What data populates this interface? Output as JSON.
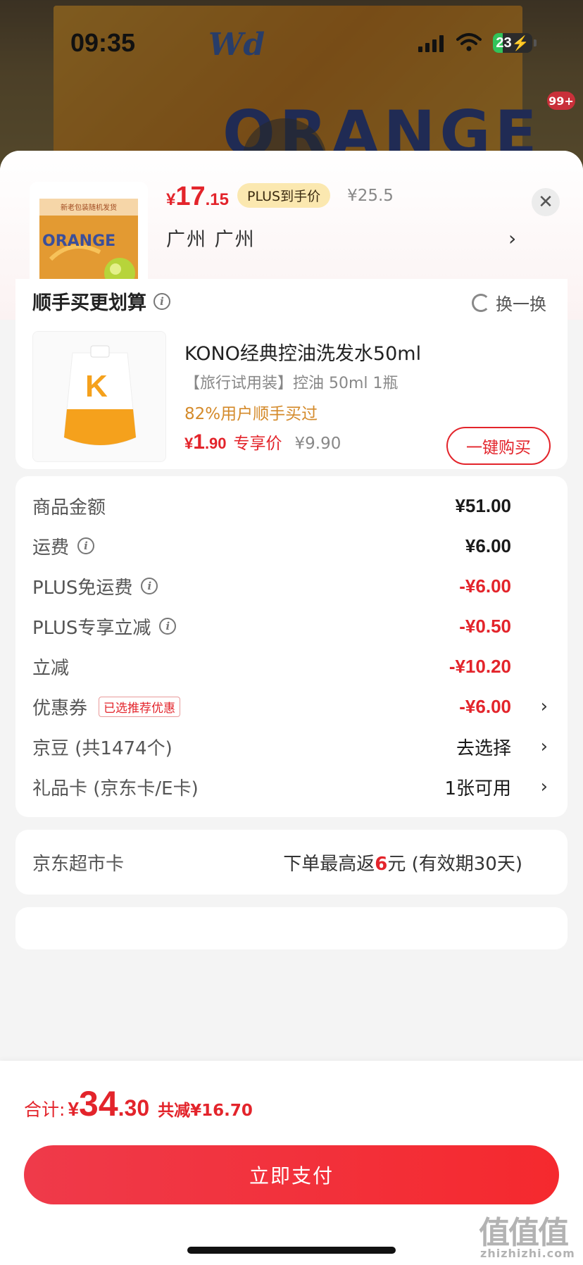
{
  "status_bar": {
    "time": "09:35",
    "battery": "23"
  },
  "background": {
    "badge": "99+"
  },
  "header": {
    "price_currency": "¥",
    "price_int": "17",
    "price_dec": ".15",
    "plus_tag": "PLUS到手价",
    "original_price": "¥25.5",
    "address": "广州  广州",
    "thumb_banner": "新老包装随机发货",
    "thumb_word": "ORANGE"
  },
  "upsell": {
    "title": "顺手买更划算",
    "swap_label": "换一换",
    "product_name": "KONO经典控油洗发水50ml",
    "spec": "【旅行试用装】控油 50ml 1瓶",
    "stat": "82%用户顺手买过",
    "price_currency": "¥",
    "price_int": "1",
    "price_dec": ".90",
    "price_tag": "专享价",
    "original_price": "¥9.90",
    "buy_label": "一键购买",
    "img_letter": "K"
  },
  "summary": {
    "rows": [
      {
        "label": "商品金额",
        "value": "¥51.00"
      },
      {
        "label": "运费",
        "value": "¥6.00"
      },
      {
        "label": "PLUS免运费",
        "value": "-¥6.00"
      },
      {
        "label": "PLUS专享立减",
        "value": "-¥0.50"
      },
      {
        "label": "立减",
        "value": "-¥10.20"
      },
      {
        "label": "优惠券",
        "tag": "已选推荐优惠",
        "value": "-¥6.00"
      },
      {
        "label": "京豆 (共1474个)",
        "value": "去选择"
      },
      {
        "label": "礼品卡 (京东卡/E卡)",
        "value": "1张可用"
      }
    ]
  },
  "supermarket": {
    "label": "京东超市卡",
    "value_pre": "下单最高返",
    "value_num": "6",
    "value_post": "元 (有效期30天)"
  },
  "footer": {
    "total_label": "合计:",
    "total_currency": "¥",
    "total_int": "34",
    "total_dec": ".30",
    "total_save": "共减¥16.70",
    "pay_label": "立即支付",
    "watermark": "值值值",
    "watermark_url": "zhizhizhi.com"
  },
  "colors": {
    "accent": "#e3242b",
    "plus_tag_bg": "#fbe8b0",
    "stat_orange": "#d48a2a"
  }
}
